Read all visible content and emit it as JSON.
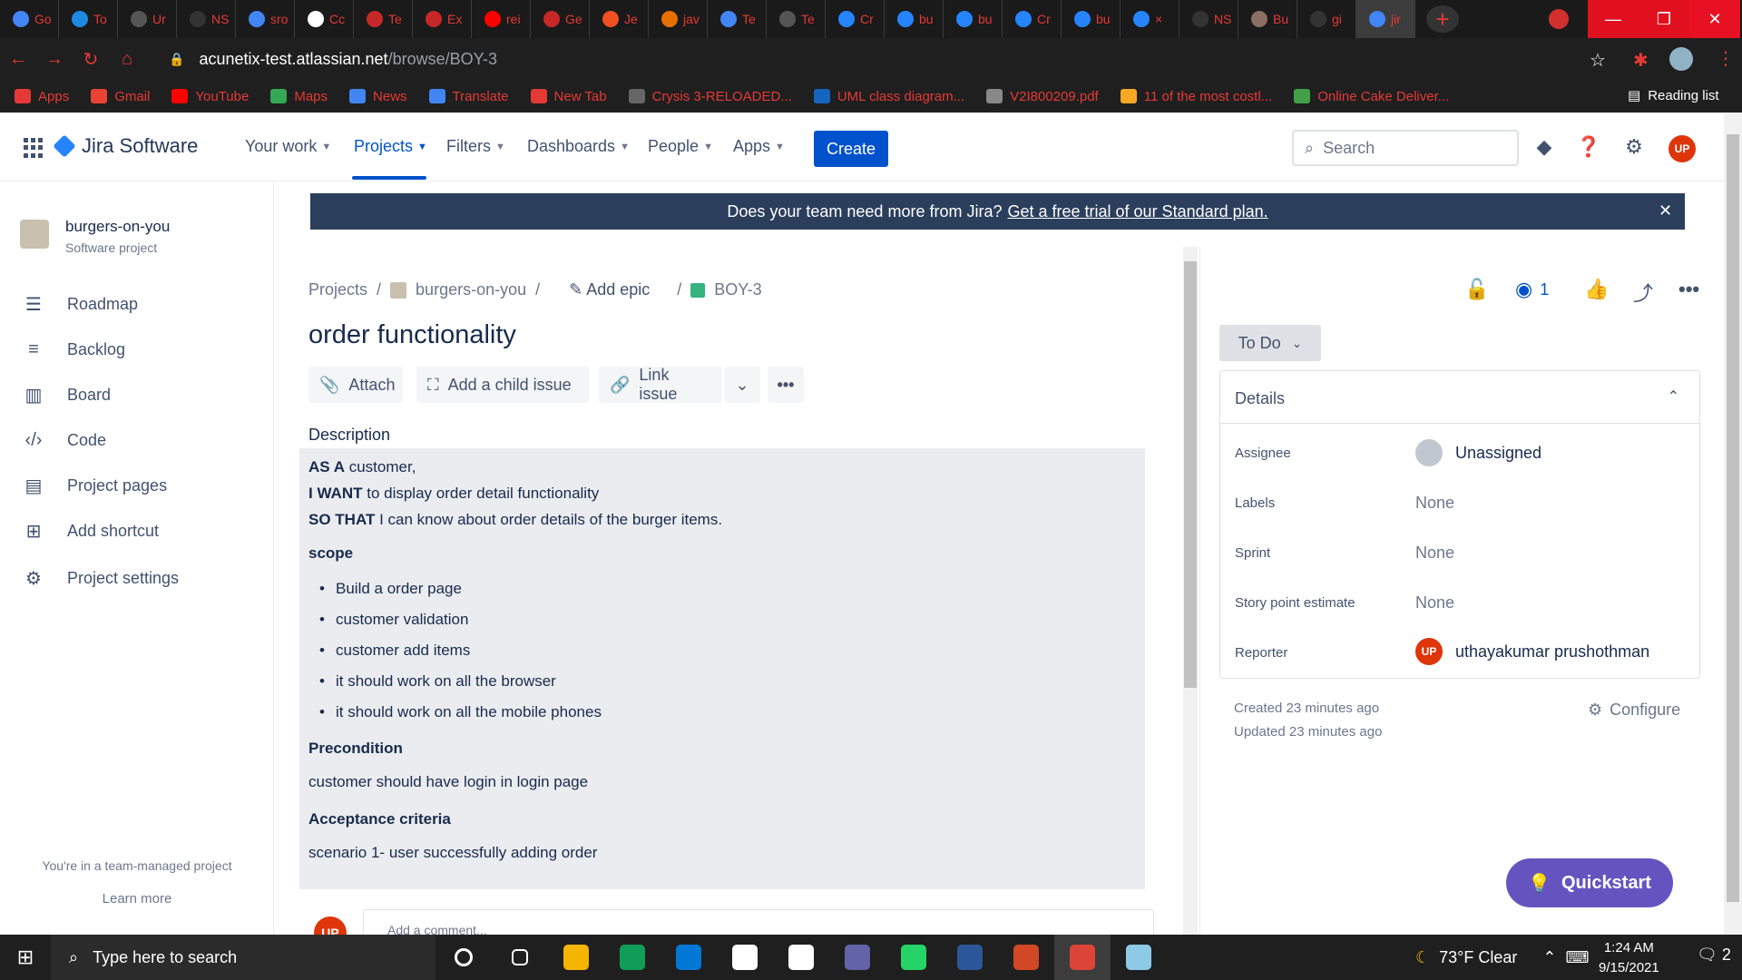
{
  "browser": {
    "tabs": [
      {
        "label": "Go",
        "color": "#4285f4"
      },
      {
        "label": "To",
        "color": "#1e88e5"
      },
      {
        "label": "Ur",
        "color": "#555555"
      },
      {
        "label": "NS",
        "color": "#333333"
      },
      {
        "label": "sro",
        "color": "#4285f4"
      },
      {
        "label": "Cc",
        "color": "#ffffff"
      },
      {
        "label": "Te",
        "color": "#c62828"
      },
      {
        "label": "Ex",
        "color": "#c62828"
      },
      {
        "label": "rei",
        "color": "#ff0000"
      },
      {
        "label": "Ge",
        "color": "#c62828"
      },
      {
        "label": "Je",
        "color": "#f25022"
      },
      {
        "label": "jav",
        "color": "#e76f00"
      },
      {
        "label": "Te",
        "color": "#4285f4"
      },
      {
        "label": "Te",
        "color": "#555555"
      },
      {
        "label": "Cr",
        "color": "#2684ff"
      },
      {
        "label": "bu",
        "color": "#2684ff"
      },
      {
        "label": "bu",
        "color": "#2684ff"
      },
      {
        "label": "Cr",
        "color": "#2684ff"
      },
      {
        "label": "bu",
        "color": "#2684ff"
      },
      {
        "label": "×",
        "color": "#2684ff"
      },
      {
        "label": "NS",
        "color": "#333333"
      },
      {
        "label": "Bu",
        "color": "#8d6e63"
      },
      {
        "label": "gi",
        "color": "#333333"
      },
      {
        "label": "jir",
        "color": "#4285f4"
      }
    ],
    "url_host": "acunetix-test.atlassian.net",
    "url_path": "/browse/BOY-3",
    "bookmarks": [
      {
        "label": "Apps",
        "color": "#e53935"
      },
      {
        "label": "Gmail",
        "color": "#ea4335"
      },
      {
        "label": "YouTube",
        "color": "#ff0000"
      },
      {
        "label": "Maps",
        "color": "#34a853"
      },
      {
        "label": "News",
        "color": "#4285f4"
      },
      {
        "label": "Translate",
        "color": "#4285f4"
      },
      {
        "label": "New Tab",
        "color": "#e53935"
      },
      {
        "label": "Crysis 3-RELOADED...",
        "color": "#666666"
      },
      {
        "label": "UML class diagram...",
        "color": "#1565c0"
      },
      {
        "label": "V2I800209.pdf",
        "color": "#888888"
      },
      {
        "label": "11 of the most costl...",
        "color": "#f9a825"
      },
      {
        "label": "Online Cake Deliver...",
        "color": "#43a047"
      }
    ],
    "reading_list": "Reading list"
  },
  "jira_nav": {
    "logo": "Jira Software",
    "items": [
      "Your work",
      "Projects",
      "Filters",
      "Dashboards",
      "People",
      "Apps"
    ],
    "create": "Create",
    "search_placeholder": "Search",
    "avatar_initials": "UP"
  },
  "sidebar": {
    "project_name": "burgers-on-you",
    "project_type": "Software project",
    "items": [
      {
        "label": "Roadmap",
        "icon": "roadmap-icon"
      },
      {
        "label": "Backlog",
        "icon": "backlog-icon"
      },
      {
        "label": "Board",
        "icon": "board-icon"
      },
      {
        "label": "Code",
        "icon": "code-icon"
      },
      {
        "label": "Project pages",
        "icon": "pages-icon"
      },
      {
        "label": "Add shortcut",
        "icon": "add-shortcut-icon"
      },
      {
        "label": "Project settings",
        "icon": "gear-icon"
      }
    ],
    "team_note": "You're in a team-managed project",
    "learn_more": "Learn more"
  },
  "banner": {
    "text": "Does your team need more from Jira?",
    "link": "Get a free trial of our Standard plan."
  },
  "issue": {
    "breadcrumb": {
      "projects": "Projects",
      "project": "burgers-on-you",
      "add_epic": "Add epic",
      "key": "BOY-3"
    },
    "title": "order functionality",
    "actions": {
      "attach": "Attach",
      "child": "Add a child issue",
      "link": "Link issue"
    },
    "description_label": "Description",
    "description": {
      "as_a_bold": "AS A",
      "as_a": " customer,",
      "i_want_bold": "I WANT",
      "i_want": " to display order detail functionality",
      "so_that_bold": "SO THAT",
      "so_that": " I can know about order details of the burger items.",
      "scope_heading": "scope",
      "scope_items": [
        "Build a order page",
        "customer validation",
        "customer add items",
        "it should work on all the browser",
        "it should work on all the mobile phones"
      ],
      "precondition_heading": "Precondition",
      "precondition": "customer should have login in login page",
      "acceptance_heading": "Acceptance criteria",
      "acceptance": "scenario 1- user successfully adding order"
    },
    "comment_avatar": "UP",
    "comment_placeholder": "Add a comment..."
  },
  "panel": {
    "watch_count": "1",
    "status": "To Do",
    "details_title": "Details",
    "fields": [
      {
        "label": "Assignee",
        "value": "Unassigned"
      },
      {
        "label": "Labels",
        "value": "None"
      },
      {
        "label": "Sprint",
        "value": "None"
      },
      {
        "label": "Story point estimate",
        "value": "None"
      },
      {
        "label": "Reporter",
        "value": "uthayakumar prushothman"
      }
    ],
    "reporter_initials": "UP",
    "created": "Created 23 minutes ago",
    "updated": "Updated 23 minutes ago",
    "configure": "Configure",
    "quickstart": "Quickstart"
  },
  "taskbar": {
    "search": "Type here to search",
    "apps": [
      {
        "name": "cortana-icon",
        "color": "#1f1f1f"
      },
      {
        "name": "task-view-icon",
        "color": "#1f1f1f"
      },
      {
        "name": "file-explorer-icon",
        "color": "#f4b400"
      },
      {
        "name": "edge-icon",
        "color": "#0f9d58"
      },
      {
        "name": "mail-icon",
        "color": "#0078d4"
      },
      {
        "name": "store-icon",
        "color": "#ffffff"
      },
      {
        "name": "amazon-icon",
        "color": "#ffffff"
      },
      {
        "name": "teams-icon",
        "color": "#6264a7"
      },
      {
        "name": "whatsapp-icon",
        "color": "#25d366"
      },
      {
        "name": "word-icon",
        "color": "#2b579a"
      },
      {
        "name": "powerpoint-icon",
        "color": "#d24726"
      },
      {
        "name": "chrome-icon",
        "color": "#db4437"
      },
      {
        "name": "notepad-icon",
        "color": "#8ecae6"
      }
    ],
    "weather": "73°F  Clear",
    "time": "1:24 AM",
    "date": "9/15/2021",
    "notifications": "2"
  }
}
